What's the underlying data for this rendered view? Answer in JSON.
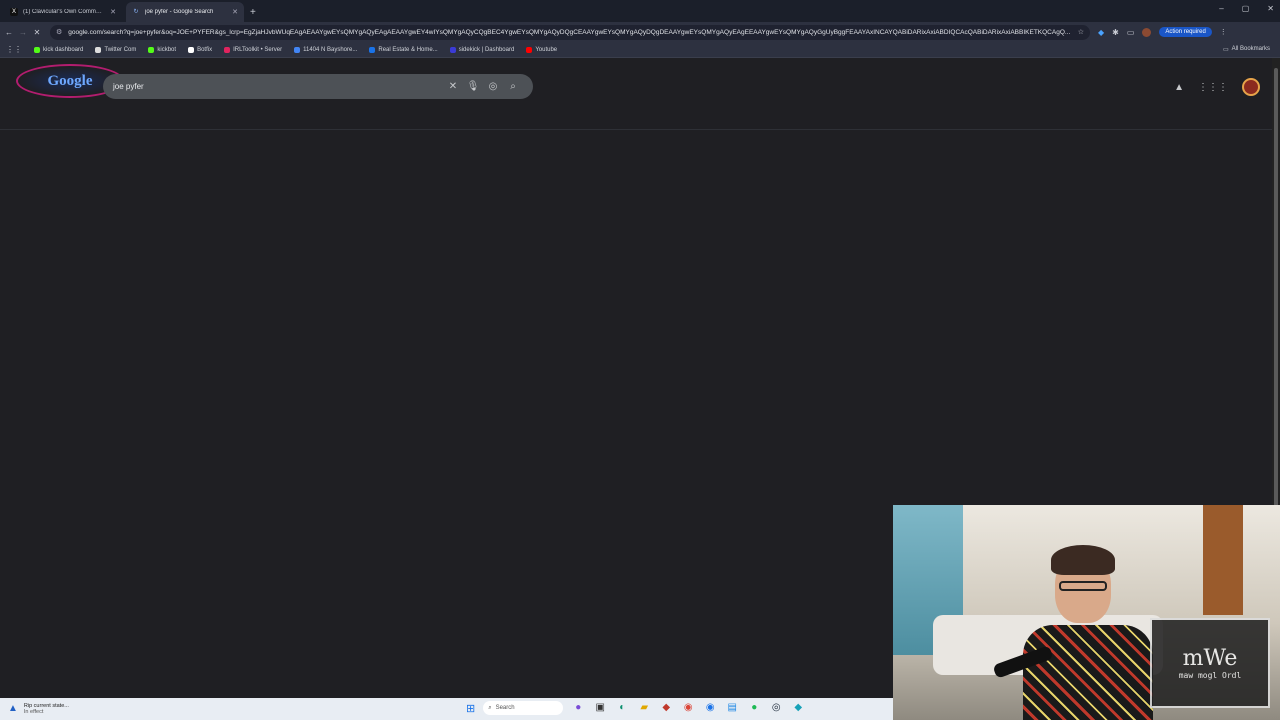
{
  "tabs": [
    {
      "title": "(1) Clavicular's Own Communi...",
      "fav_color": "#111111",
      "fav": "X",
      "active": false
    },
    {
      "title": "joe pyfer - Google Search",
      "fav_color": "#8ab4f8",
      "fav": "↻",
      "active": true
    }
  ],
  "new_tab": "+",
  "window_controls": [
    "–",
    "▢",
    "✕"
  ],
  "toolbar": {
    "url": "google.com/search?q=joe+pyfer&oq=JOE+PYFER&gs_lcrp=EgZjaHJvbWUqEAgAEAAYgwEYsQMYgAQyEAgAEAAYgwEY4wIYsQMYgAQyCQgBEC4YgwEYsQMYgAQyDQgCEAAYgwEYsQMYgAQyDQgDEAAYgwEYsQMYgAQyEAgEEAAYgwEYsQMYgAQyGgUyBggFEAAYAxINCAYQABiDARixAxiABDIQCAcQABiDARixAxiABBIKETKQCAgQ...",
    "action_required": "Action required"
  },
  "bookmarks": [
    {
      "label": "kick dashboard",
      "color": "#53fc18"
    },
    {
      "label": "Twitter Com",
      "color": "#dddddd"
    },
    {
      "label": "kickbot",
      "color": "#53fc18"
    },
    {
      "label": "Botfix",
      "color": "#ffffff"
    },
    {
      "label": "IRLToolkit • Server",
      "color": "#e0245e"
    },
    {
      "label": "11404 N Bayshore...",
      "color": "#4285f4"
    },
    {
      "label": "Real Estate & Home...",
      "color": "#1a73e8"
    },
    {
      "label": "sidekick | Dashboard",
      "color": "#3b3bd6"
    },
    {
      "label": "Youtube",
      "color": "#ff0000"
    }
  ],
  "all_bookmarks": "All Bookmarks",
  "google": {
    "logo_text": "Google",
    "query": "joe pyfer"
  },
  "webcam": {
    "badge_title": "mWe",
    "badge_sub": "maw mogl Ordl"
  },
  "taskbar": {
    "weather_line1": "Rip current state...",
    "weather_line2": "In effect",
    "search_placeholder": "Search"
  }
}
